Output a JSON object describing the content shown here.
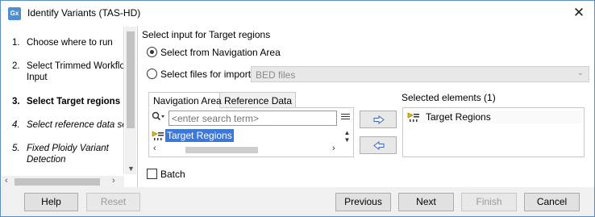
{
  "window": {
    "title": "Identify Variants (TAS-HD)",
    "app_icon": "Gx",
    "close_glyph": "✕"
  },
  "steps": [
    {
      "num": "1.",
      "label": "Choose where to run",
      "style": "normal"
    },
    {
      "num": "2.",
      "label": "Select Trimmed Workflow",
      "label2": "Input",
      "style": "normal"
    },
    {
      "num": "3.",
      "label": "Select Target regions",
      "style": "bold"
    },
    {
      "num": "4.",
      "label": "Select reference data se",
      "style": "italic"
    },
    {
      "num": "5.",
      "label": "Fixed Ploidy Variant",
      "label2": "Detection",
      "style": "italic"
    }
  ],
  "main": {
    "section_title": "Select input for Target regions",
    "radio_navigation": "Select from Navigation Area",
    "radio_files": "Select files for import:",
    "file_type": "BED files",
    "tabs": [
      "Navigation Area",
      "Reference Data"
    ],
    "search_placeholder": "<enter search term>",
    "nav_item": "Target Regions",
    "selected_label": "Selected elements (1)",
    "selected_item": "Target Regions",
    "batch_label": "Batch"
  },
  "footer": {
    "help": "Help",
    "reset": "Reset",
    "previous": "Previous",
    "next": "Next",
    "finish": "Finish",
    "cancel": "Cancel"
  },
  "colors": {
    "accent": "#3c78d8",
    "window_border": "#5a8fc4"
  }
}
